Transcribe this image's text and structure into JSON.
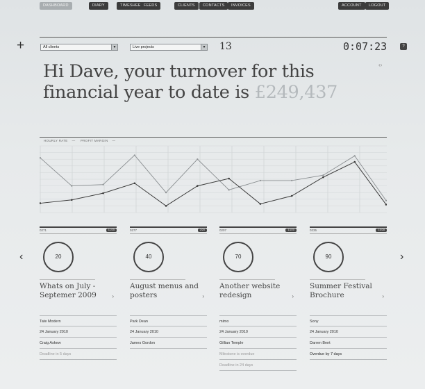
{
  "nav": {
    "dashboard": "DASHBOARD",
    "diary": "DIARY",
    "timesheets": "TIMESHEETS",
    "feeds": "FEEDS",
    "clients": "CLIENTS",
    "contacts": "CONTACTS",
    "invoices": "INVOICES",
    "account": "ACCOUNT",
    "logout": "LOGOUT"
  },
  "toolbar": {
    "add_icon": "+",
    "clients_filter": "All clients",
    "projects_filter": "Live projects",
    "project_count": "13",
    "timer": "0:07:23",
    "help_icon": "?"
  },
  "headline": {
    "text": "Hi Dave, your turnover for this financial year to date is",
    "amount": "£249,437"
  },
  "chart_data": {
    "type": "line",
    "legend": [
      "HOURLY RATE",
      "PROFIT MARGIN"
    ],
    "x": [
      1,
      2,
      3,
      4,
      5,
      6,
      7,
      8,
      9,
      10,
      11,
      12
    ],
    "series": [
      {
        "name": "HOURLY RATE",
        "values": [
          82,
          40,
          42,
          86,
          30,
          80,
          34,
          48,
          48,
          56,
          85,
          18
        ]
      },
      {
        "name": "PROFIT MARGIN",
        "values": [
          14,
          19,
          29,
          44,
          10,
          40,
          51,
          13,
          25,
          53,
          76,
          12
        ]
      }
    ],
    "ylim": [
      0,
      100
    ],
    "grid": true
  },
  "nav_arrows": {
    "prev": "‹",
    "next": "›"
  },
  "projects": [
    {
      "code": "0271",
      "badge": "11/25",
      "progress": "20",
      "title": "Whats on July -Septemer 2009",
      "client": "Tate Modern",
      "date": "24 January 2010",
      "contact": "Craig Askew",
      "status": "Deadline in 5 days",
      "status_dim": true,
      "extra": ""
    },
    {
      "code": "0277",
      "badge": "2/20",
      "progress": "40",
      "title": "August menus and posters",
      "client": "Park Dean",
      "date": "24 January 2010",
      "contact": "James Gordon",
      "status": "",
      "status_dim": true,
      "extra": ""
    },
    {
      "code": "0207",
      "badge": "13/20",
      "progress": "70",
      "title": "Another website redesign",
      "client": "mimo",
      "date": "24 January 2010",
      "contact": "Gillian Temple",
      "status": "Milestone is overdue",
      "status_dim": true,
      "extra": "Deadline in 24 days"
    },
    {
      "code": "0235",
      "badge": "15/28",
      "progress": "90",
      "title": "Summer Festival Brochure",
      "client": "Sony",
      "date": "24 January 2010",
      "contact": "Darren Bent",
      "status": "Overdue by 7 days",
      "status_dim": false,
      "extra": ""
    }
  ]
}
